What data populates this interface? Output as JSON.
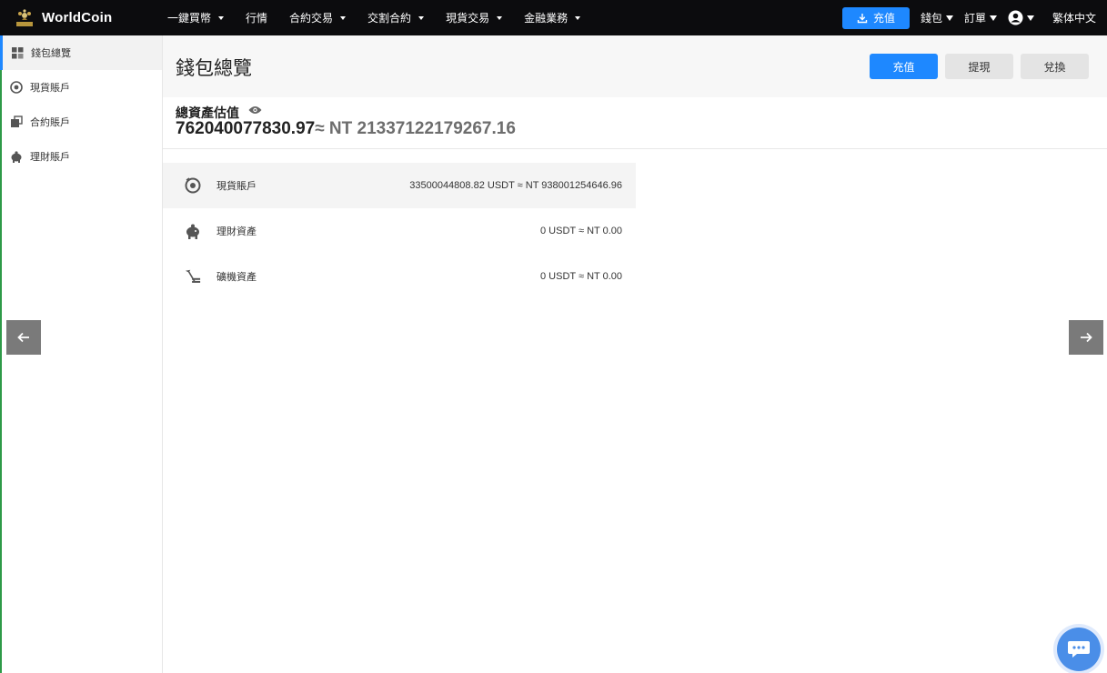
{
  "brand": {
    "name": "WorldCoin"
  },
  "nav": {
    "items": [
      {
        "label": "一鍵買幣",
        "has_dropdown": true
      },
      {
        "label": "行情",
        "has_dropdown": false
      },
      {
        "label": "合約交易",
        "has_dropdown": true
      },
      {
        "label": "交割合約",
        "has_dropdown": true
      },
      {
        "label": "現貨交易",
        "has_dropdown": true
      },
      {
        "label": "金融業務",
        "has_dropdown": true
      }
    ]
  },
  "top_right": {
    "deposit_label": "充值",
    "wallet_label": "錢包",
    "orders_label": "訂單",
    "language_label": "繁体中文"
  },
  "sidebar": {
    "items": [
      {
        "label": "錢包總覽",
        "icon": "grid-icon",
        "active": true
      },
      {
        "label": "現貨賬戶",
        "icon": "coin-icon",
        "active": false
      },
      {
        "label": "合約賬戶",
        "icon": "contract-icon",
        "active": false
      },
      {
        "label": "理財賬戶",
        "icon": "piggy-icon",
        "active": false
      }
    ]
  },
  "header": {
    "title": "錢包總覽",
    "buttons": {
      "deposit": "充值",
      "withdraw": "提現",
      "exchange": "兌換"
    }
  },
  "summary": {
    "label": "總資產估值",
    "value": "762040077830.97",
    "approx": "≈ NT 21337122179267.16"
  },
  "accounts": [
    {
      "name": "現貨賬戶",
      "value": "33500044808.82 USDT ≈ NT 938001254646.96",
      "icon": "coin-icon"
    },
    {
      "name": "理財資產",
      "value": "0 USDT ≈ NT 0.00",
      "icon": "piggy-icon"
    },
    {
      "name": "礦機資產",
      "value": "0 USDT ≈ NT 0.00",
      "icon": "mining-icon"
    }
  ],
  "colors": {
    "accent": "#1e88ff",
    "topbar": "#0c0c0e",
    "arrow": "#7a7a7a"
  }
}
